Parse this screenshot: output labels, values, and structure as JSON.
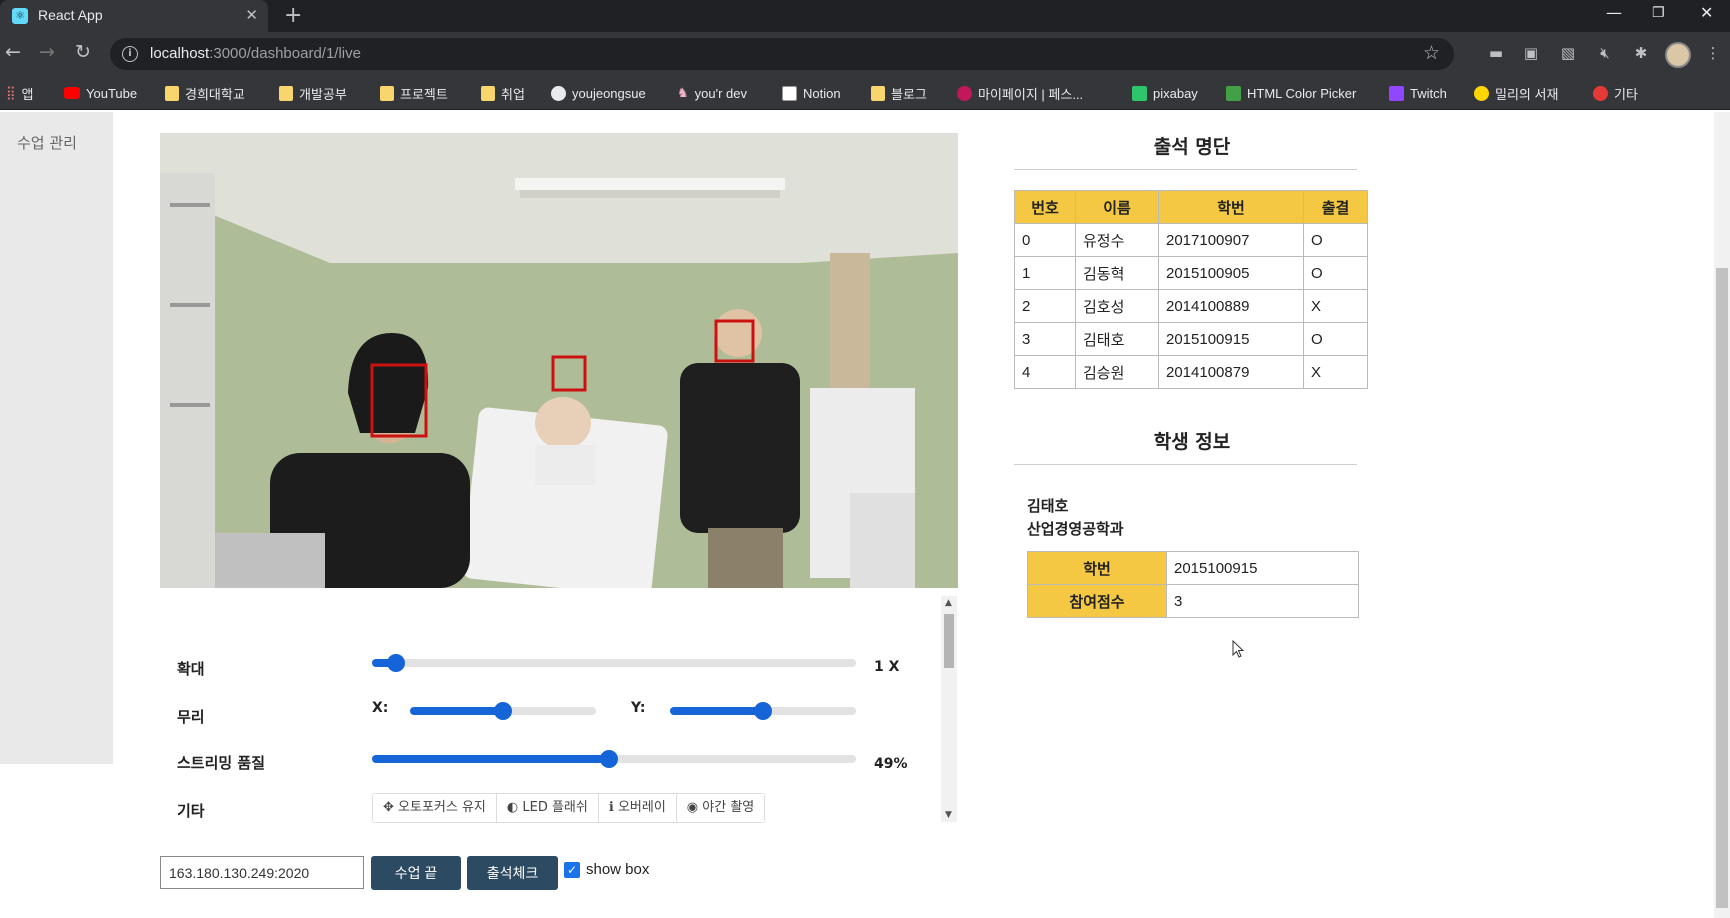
{
  "browser": {
    "tab_title": "React App",
    "url_host": "localhost",
    "url_path": ":3000/dashboard/1/live",
    "bookmarks": [
      {
        "label": "앱",
        "icon": "apps-icon"
      },
      {
        "label": "YouTube",
        "icon": "youtube-icon"
      },
      {
        "label": "경희대학교",
        "icon": "folder-icon"
      },
      {
        "label": "개발공부",
        "icon": "folder-icon"
      },
      {
        "label": "프로젝트",
        "icon": "folder-icon"
      },
      {
        "label": "취업",
        "icon": "folder-icon"
      },
      {
        "label": "youjeongsue",
        "icon": "github-icon"
      },
      {
        "label": "you'r dev",
        "icon": "bunny-icon"
      },
      {
        "label": "Notion",
        "icon": "notion-icon"
      },
      {
        "label": "블로그",
        "icon": "folder-icon"
      },
      {
        "label": "마이페이지 | 페스...",
        "icon": "site-icon"
      },
      {
        "label": "pixabay",
        "icon": "pixabay-icon"
      },
      {
        "label": "HTML Color Picker",
        "icon": "color-picker-icon"
      },
      {
        "label": "Twitch",
        "icon": "twitch-icon"
      },
      {
        "label": "밀리의 서재",
        "icon": "millie-icon"
      },
      {
        "label": "기타",
        "icon": "site-icon"
      }
    ]
  },
  "sidebar": {
    "items": [
      {
        "label": "수업 관리"
      }
    ]
  },
  "controls": {
    "zoom": {
      "label": "확대",
      "value": "1 X",
      "level": 0.05
    },
    "pan": {
      "label": "무리",
      "x_label": "X:",
      "y_label": "Y:",
      "x_level": 0.5,
      "y_level": 0.5
    },
    "quality": {
      "label": "스트리밍 품질",
      "value": "49%",
      "level": 0.49
    },
    "etc": {
      "label": "기타",
      "buttons": [
        {
          "label": "오토포커스 유지",
          "icon": "crosshair-icon"
        },
        {
          "label": "LED 플래쉬",
          "icon": "half-circle-icon"
        },
        {
          "label": "오버레이",
          "icon": "info-icon"
        },
        {
          "label": "야간 촬영",
          "icon": "eye-icon"
        }
      ]
    }
  },
  "footer": {
    "ip_value": "163.180.130.249:2020",
    "end_class_label": "수업 끝",
    "attendance_check_label": "출석체크",
    "show_box_label": "show box",
    "show_box_checked": true
  },
  "attendance": {
    "title": "출석 명단",
    "headers": [
      "번호",
      "이름",
      "학번",
      "출결"
    ],
    "rows": [
      [
        "0",
        "유정수",
        "2017100907",
        "O"
      ],
      [
        "1",
        "김동혁",
        "2015100905",
        "O"
      ],
      [
        "2",
        "김호성",
        "2014100889",
        "X"
      ],
      [
        "3",
        "김태호",
        "2015100915",
        "O"
      ],
      [
        "4",
        "김승원",
        "2014100879",
        "X"
      ]
    ]
  },
  "student": {
    "title": "학생 정보",
    "name": "김태호",
    "department": "산업경영공학과",
    "fields": [
      {
        "label": "학번",
        "value": "2015100915"
      },
      {
        "label": "참여점수",
        "value": "3"
      }
    ]
  },
  "colors": {
    "accent": "#1565d8",
    "table_header": "#f4c842",
    "button_dark": "#2d4a63"
  }
}
